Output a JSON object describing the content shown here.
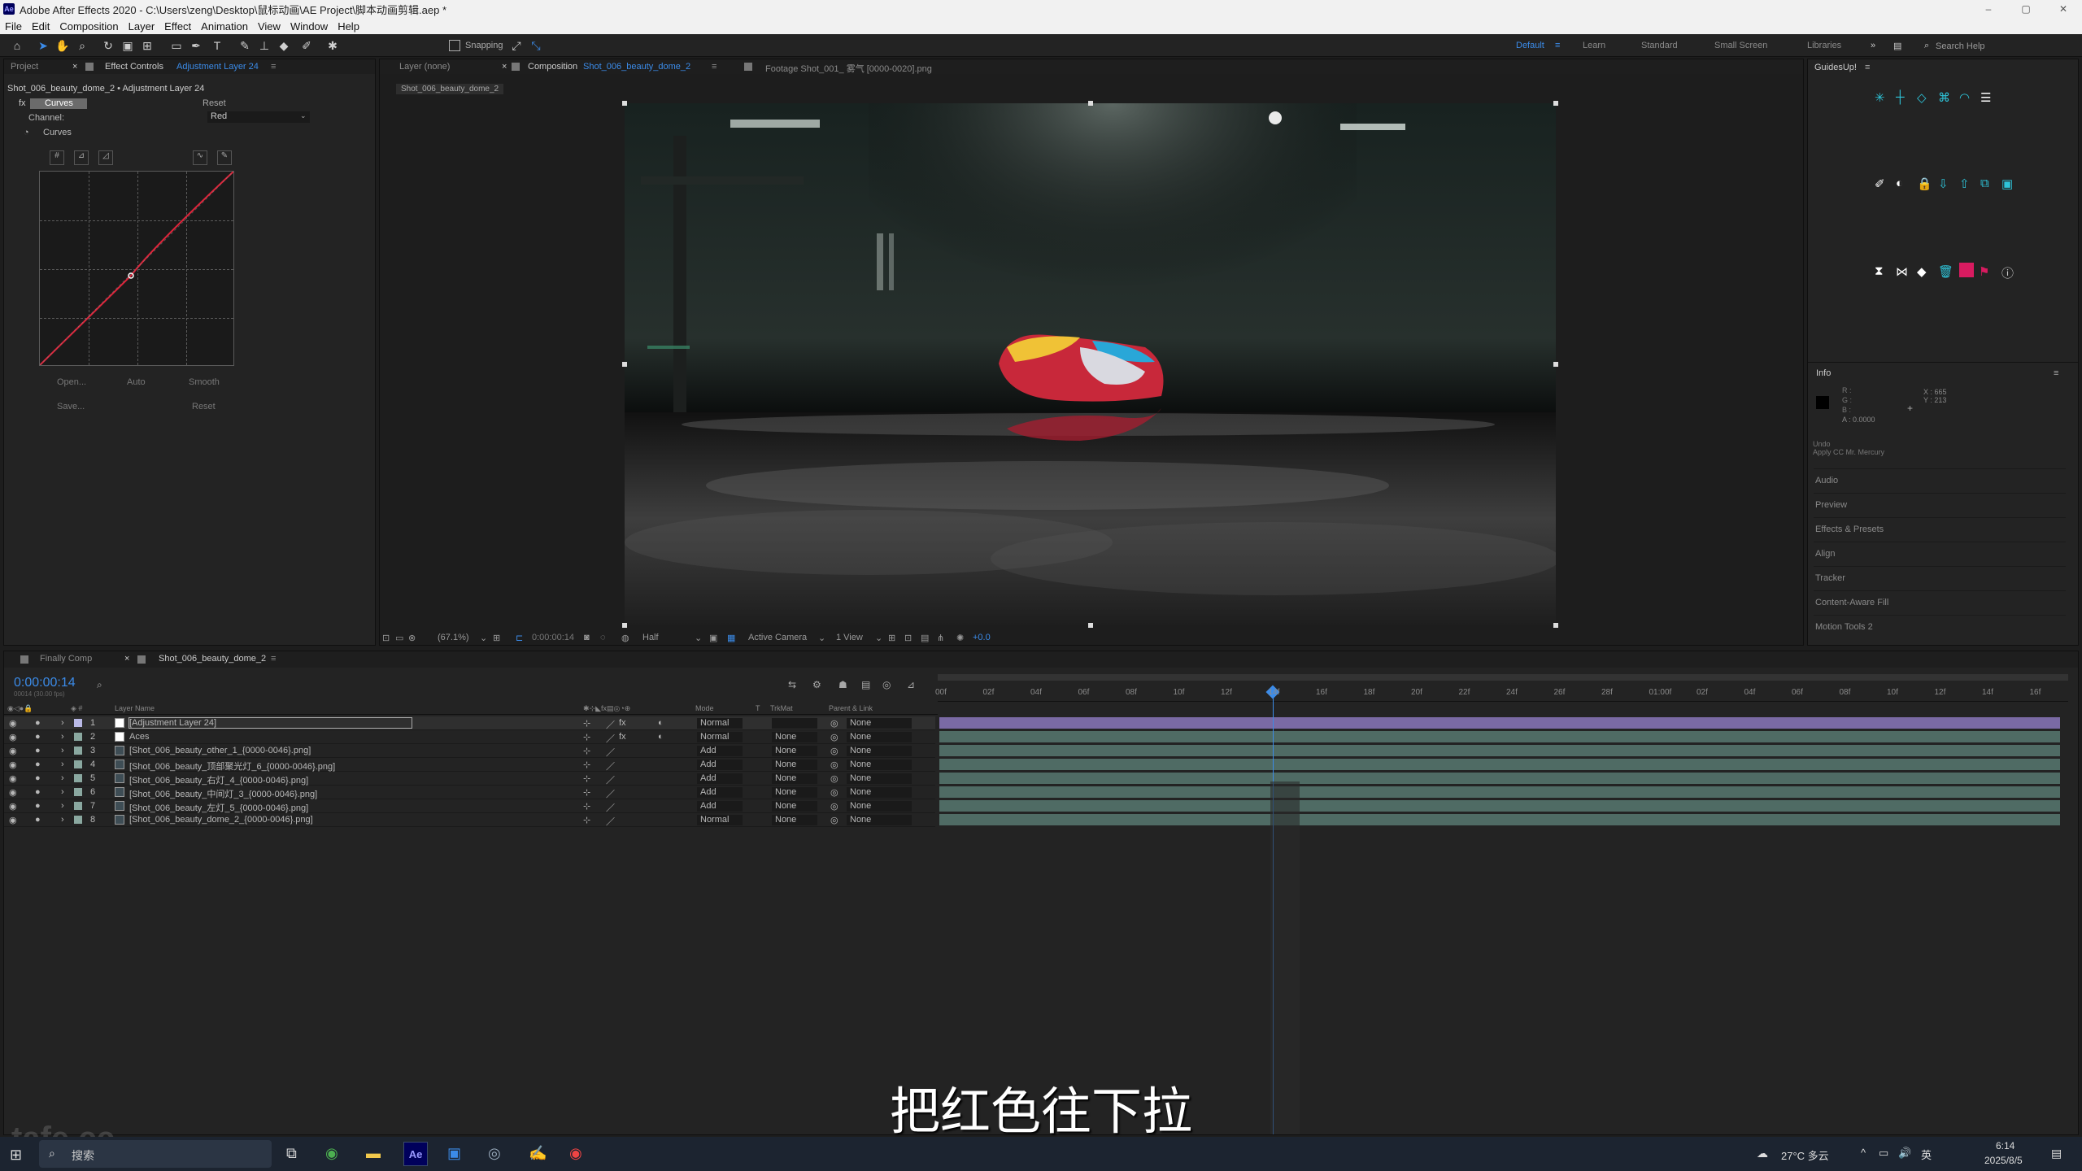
{
  "window": {
    "logo_text": "Ae",
    "title": "Adobe After Effects 2020 - C:\\Users\\zeng\\Desktop\\鼠标动画\\AE Project\\脚本动画剪辑.aep *",
    "minimize": "–",
    "maximize": "▢",
    "close": "✕"
  },
  "menu": [
    "File",
    "Edit",
    "Composition",
    "Layer",
    "Effect",
    "Animation",
    "View",
    "Window",
    "Help"
  ],
  "toolbar": {
    "snapping_label": "Snapping",
    "workspaces": [
      "Default",
      "Learn",
      "Standard",
      "Small Screen",
      "Libraries"
    ],
    "active_workspace": "Default",
    "search_placeholder": "Search Help"
  },
  "left_panel": {
    "tab_project": "Project",
    "tab_effect_controls": "Effect Controls",
    "tab_effect_controls_target": "Adjustment Layer 24",
    "breadcrumb": "Shot_006_beauty_dome_2 • Adjustment Layer 24",
    "effect_name": "Curves",
    "reset_label": "Reset",
    "channel_label": "Channel:",
    "channel_value": "Red",
    "curves_label": "Curves",
    "buttons": {
      "open": "Open...",
      "auto": "Auto",
      "smooth": "Smooth",
      "save": "Save...",
      "reset": "Reset"
    }
  },
  "viewer": {
    "tab_layer": "Layer (none)",
    "tab_composition_prefix": "Composition",
    "tab_composition": "Shot_006_beauty_dome_2",
    "tab_footage": "Footage Shot_001_ 雾气 [0000-0020].png",
    "comp_subtab": "Shot_006_beauty_dome_2",
    "zoom": "(67.1%)",
    "timecode": "0:00:00:14",
    "resolution": "Half",
    "camera": "Active Camera",
    "views": "1 View",
    "exposure": "+0.0"
  },
  "right_panel": {
    "guides_title": "GuidesUp!",
    "info_title": "Info",
    "info_r": "R :",
    "info_g": "G :",
    "info_b": "B :",
    "info_a": "A : 0.0000",
    "info_x": "X : 665",
    "info_y": "Y : 213",
    "undo_label": "Undo",
    "undo_action": "Apply CC Mr. Mercury",
    "items": [
      "Audio",
      "Preview",
      "Effects & Presets",
      "Align",
      "Tracker",
      "Content-Aware Fill",
      "Motion Tools 2"
    ]
  },
  "timeline": {
    "tabs": [
      "Finally Comp",
      "Shot_006_beauty_dome_2"
    ],
    "timecode": "0:00:00:14",
    "fps": "00014 (30.00 fps)",
    "col_layer_name": "Layer Name",
    "col_mode": "Mode",
    "col_t": "T",
    "col_trkmat": "TrkMat",
    "col_parent": "Parent & Link",
    "ruler": [
      "00f",
      "02f",
      "04f",
      "06f",
      "08f",
      "10f",
      "12f",
      "14f",
      "16f",
      "18f",
      "20f",
      "22f",
      "24f",
      "26f",
      "28f",
      "01:00f",
      "02f",
      "04f",
      "06f",
      "08f",
      "10f",
      "12f",
      "14f",
      "16f"
    ],
    "layers": [
      {
        "num": "1",
        "name": "[Adjustment Layer 24]",
        "mode": "Normal",
        "trkmat": "",
        "parent": "None"
      },
      {
        "num": "2",
        "name": "Aces",
        "mode": "Normal",
        "trkmat": "None",
        "parent": "None"
      },
      {
        "num": "3",
        "name": "[Shot_006_beauty_other_1_{0000-0046}.png]",
        "mode": "Add",
        "trkmat": "None",
        "parent": "None"
      },
      {
        "num": "4",
        "name": "[Shot_006_beauty_顶部聚光灯_6_{0000-0046}.png]",
        "mode": "Add",
        "trkmat": "None",
        "parent": "None"
      },
      {
        "num": "5",
        "name": "[Shot_006_beauty_右灯_4_{0000-0046}.png]",
        "mode": "Add",
        "trkmat": "None",
        "parent": "None"
      },
      {
        "num": "6",
        "name": "[Shot_006_beauty_中间灯_3_{0000-0046}.png]",
        "mode": "Add",
        "trkmat": "None",
        "parent": "None"
      },
      {
        "num": "7",
        "name": "[Shot_006_beauty_左灯_5_{0000-0046}.png]",
        "mode": "Add",
        "trkmat": "None",
        "parent": "None"
      },
      {
        "num": "8",
        "name": "[Shot_006_beauty_dome_2_{0000-0046}.png]",
        "mode": "Normal",
        "trkmat": "None",
        "parent": "None"
      }
    ]
  },
  "subtitle": "把红色往下拉",
  "watermark": "tafe.cc",
  "taskbar": {
    "search_placeholder": "搜索",
    "weather": "27°C 多云",
    "lang": "英",
    "time": "6:14",
    "date": "2025/8/5"
  },
  "colors": {
    "accent": "#3b8be8",
    "curve_red": "#e0243a",
    "adjustment_bar": "#7a6aa4",
    "layer_bar": "#4f6b64"
  }
}
